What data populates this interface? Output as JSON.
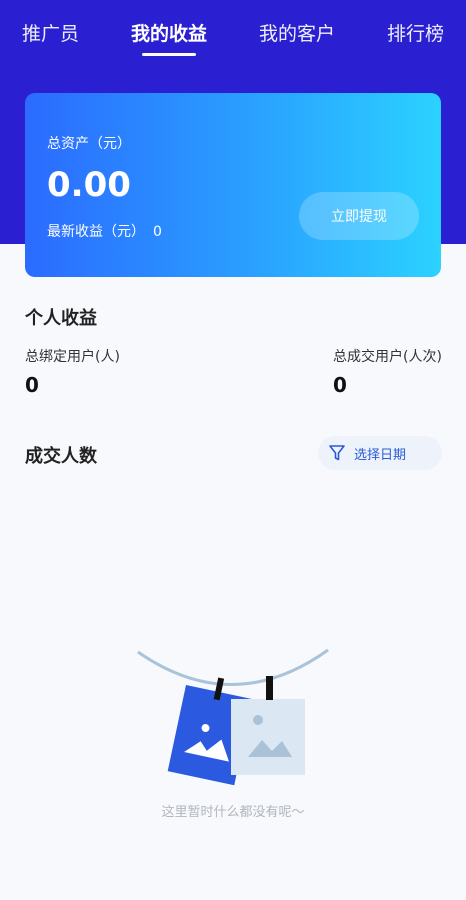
{
  "tabs": [
    {
      "label": "推广员",
      "active": false
    },
    {
      "label": "我的收益",
      "active": true
    },
    {
      "label": "我的客户",
      "active": false
    },
    {
      "label": "排行榜",
      "active": false
    }
  ],
  "card": {
    "total_label": "总资产（元）",
    "total_amount": "0.00",
    "recent_label": "最新收益（元）",
    "recent_value": "0",
    "withdraw_label": "立即提现"
  },
  "personal": {
    "title": "个人收益",
    "bound_users_label": "总绑定用户(人)",
    "bound_users_value": "0",
    "deal_users_label": "总成交用户(人次)",
    "deal_users_value": "0"
  },
  "deals": {
    "title": "成交人数",
    "date_filter_label": "选择日期",
    "empty_text": "这里暂时什么都没有呢～"
  },
  "colors": {
    "header_bg": "#2a20d2",
    "card_gradient_start": "#2b6bff",
    "card_gradient_end": "#2bd2ff",
    "accent": "#2a5bd7"
  }
}
